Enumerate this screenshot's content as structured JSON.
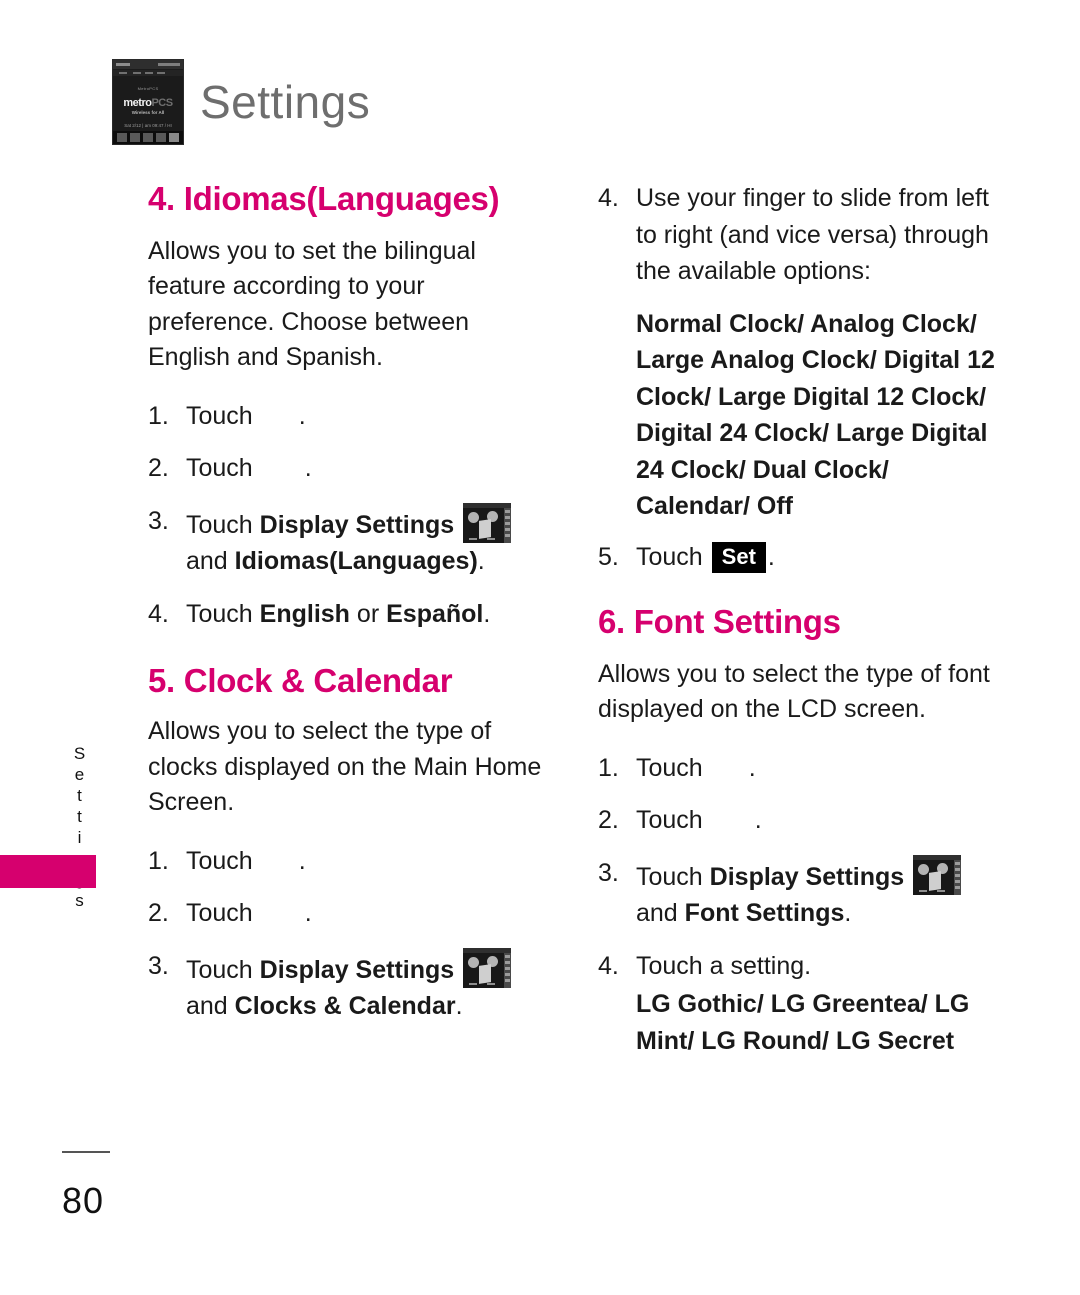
{
  "header": {
    "title": "Settings",
    "phone_thumbnail": {
      "tiny_text": "MetroPCS",
      "logo_main": "metro",
      "logo_suffix": "PCS",
      "tagline": "Wireless for All",
      "date_time": "Sat 2/12 | am 09:47 / HI"
    }
  },
  "side_tab": {
    "label": "Settings"
  },
  "left_column": {
    "section4": {
      "heading": "4. Idiomas(Languages)",
      "body": "Allows you to set the bilingual feature according to your preference. Choose between English and Spanish.",
      "steps": [
        {
          "num": "1.",
          "text_before": "Touch",
          "text_after": "."
        },
        {
          "num": "2.",
          "text_before": "Touch",
          "text_after": "."
        },
        {
          "num": "3.",
          "text_before": "Touch",
          "bold1": "Display Settings",
          "text_mid": "and",
          "bold2": "Idiomas(Languages)",
          "text_after": "."
        },
        {
          "num": "4.",
          "text_before": "Touch",
          "bold1": "English",
          "text_mid": "or",
          "bold2": "Español",
          "text_after": "."
        }
      ]
    },
    "section5": {
      "heading": "5. Clock & Calendar",
      "body": "Allows you to select the type of clocks displayed on the Main Home Screen.",
      "steps": [
        {
          "num": "1.",
          "text_before": "Touch",
          "text_after": "."
        },
        {
          "num": "2.",
          "text_before": "Touch",
          "text_after": "."
        },
        {
          "num": "3.",
          "text_before": "Touch",
          "bold1": "Display Settings",
          "text_mid": "and",
          "bold2": "Clocks & Calendar",
          "text_after": "."
        }
      ]
    }
  },
  "right_column": {
    "step4": {
      "num": "4.",
      "text": "Use your finger to slide from left to right (and vice versa) through the available options:"
    },
    "clock_options": "Normal Clock/ Analog Clock/ Large Analog Clock/ Digital 12 Clock/ Large Digital 12 Clock/ Digital 24 Clock/ Large Digital 24 Clock/ Dual Clock/ Calendar/ Off",
    "step5": {
      "num": "5.",
      "text_before": "Touch",
      "button_label": "Set",
      "text_after": "."
    },
    "section6": {
      "heading": "6. Font Settings",
      "body": "Allows you to select the type of font displayed on the LCD screen.",
      "steps": [
        {
          "num": "1.",
          "text_before": "Touch",
          "text_after": "."
        },
        {
          "num": "2.",
          "text_before": "Touch",
          "text_after": "."
        },
        {
          "num": "3.",
          "text_before": "Touch",
          "bold1": "Display Settings",
          "text_mid": "and",
          "bold2": "Font Settings",
          "text_after": "."
        },
        {
          "num": "4.",
          "text_before": "Touch a setting."
        }
      ],
      "font_options": "LG Gothic/ LG Greentea/ LG Mint/ LG Round/ LG Secret"
    }
  },
  "footer": {
    "page_number": "80"
  },
  "colors": {
    "accent": "#d6006e",
    "title_gray": "#6e6e6e",
    "text": "#1a1a1a"
  }
}
